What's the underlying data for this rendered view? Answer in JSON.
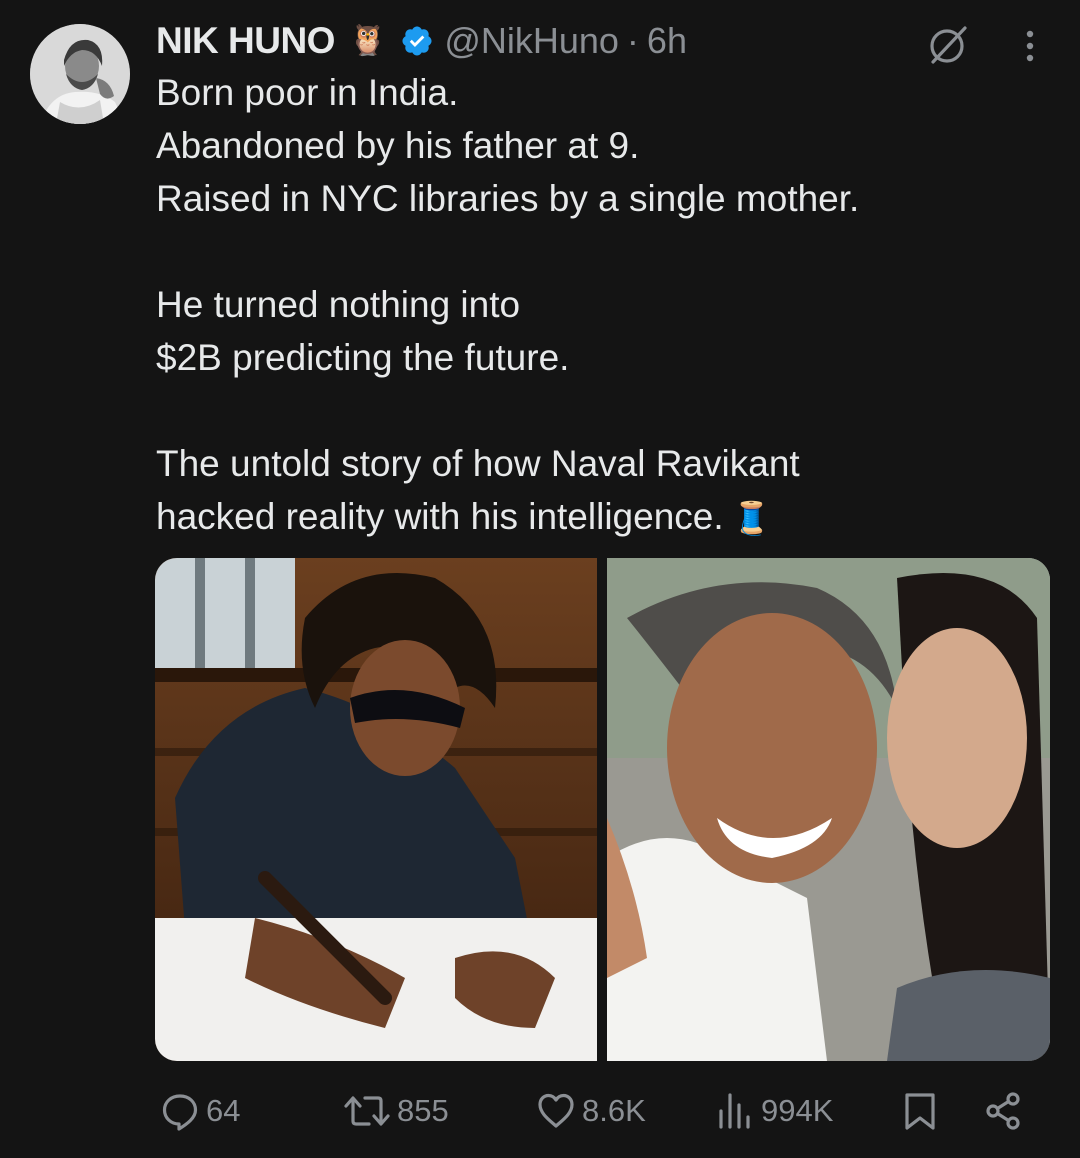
{
  "author": {
    "name": "NIK HUNO",
    "badge_emoji": "🦉",
    "verified": true,
    "handle": "@NikHuno",
    "separator": "·",
    "time": "6h"
  },
  "tweet": {
    "lines": [
      "Born poor in India.",
      "Abandoned by his father at 9.",
      "Raised in NYC libraries by a single mother.",
      "",
      "He turned nothing into",
      "$2B predicting the future.",
      "",
      "The untold story of how Naval Ravikant",
      "hacked reality with his intelligence."
    ],
    "thread_emoji": "🧵"
  },
  "actions": {
    "replies": "64",
    "reposts": "855",
    "likes": "8.6K",
    "views": "994K"
  },
  "icons": {
    "reply": "reply-icon",
    "repost": "repost-icon",
    "like": "heart-icon",
    "views": "views-icon",
    "bookmark": "bookmark-icon",
    "share": "share-icon",
    "grok": "grok-icon",
    "more": "more-icon"
  },
  "colors": {
    "background": "#141414",
    "text": "#e7e9ea",
    "secondary": "#8b8f94",
    "verified": "#1d9bf0"
  }
}
